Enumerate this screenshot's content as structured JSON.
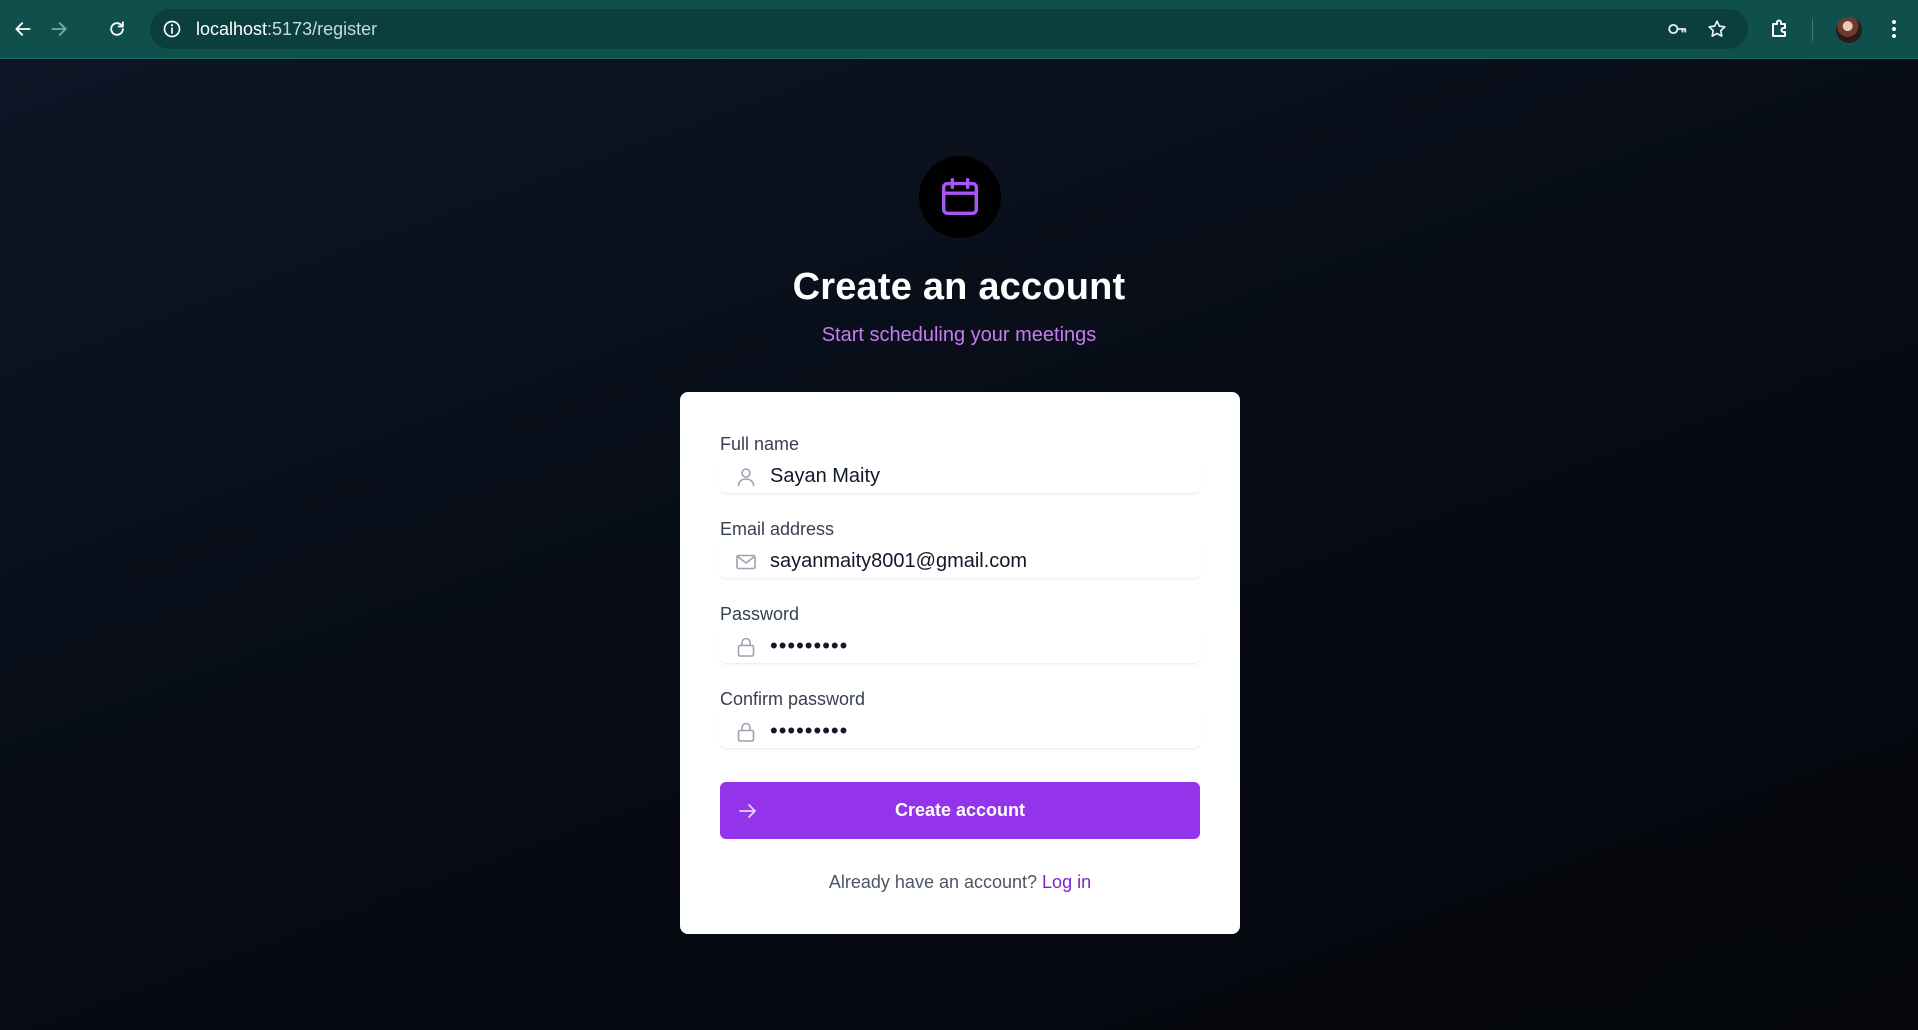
{
  "browser": {
    "url_host": "localhost",
    "url_path": ":5173/register",
    "icons": {
      "back": "arrow-left-icon",
      "forward": "arrow-right-icon",
      "reload": "reload-icon",
      "site_info": "info-icon",
      "password_manager": "key-icon",
      "bookmark": "star-icon",
      "extensions": "puzzle-icon",
      "profile": "avatar",
      "menu": "kebab-menu-icon"
    }
  },
  "page": {
    "logo_icon": "calendar-icon",
    "title": "Create an account",
    "subtitle": "Start scheduling your meetings"
  },
  "form": {
    "full_name": {
      "label": "Full name",
      "value": "Sayan Maity",
      "icon": "user-icon"
    },
    "email": {
      "label": "Email address",
      "value": "sayanmaity8001@gmail.com",
      "icon": "mail-icon"
    },
    "password": {
      "label": "Password",
      "value": "•••••••••",
      "icon": "lock-icon"
    },
    "confirm_password": {
      "label": "Confirm password",
      "value": "•••••••••",
      "icon": "lock-icon"
    },
    "submit": {
      "label": "Create account",
      "icon": "arrow-right-icon"
    },
    "footer": {
      "prompt": "Already have an account? ",
      "link": "Log in"
    }
  },
  "colors": {
    "chrome_bg": "#0f4f4c",
    "page_bg": "#080c14",
    "accent": "#9333ea",
    "subtitle": "#c57cf0",
    "card_bg": "#ffffff"
  }
}
